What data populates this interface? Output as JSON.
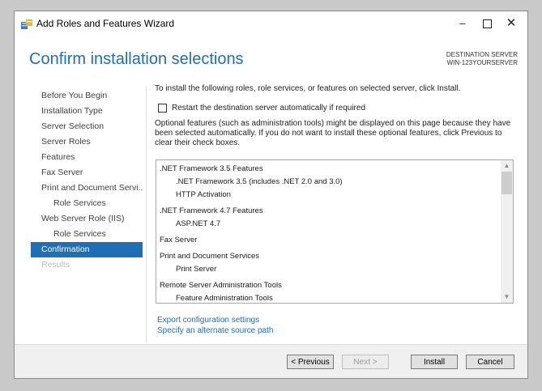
{
  "window": {
    "title": "Add Roles and Features Wizard",
    "icon": "server-manager-icon",
    "controls": {
      "minimize": "–",
      "close": "✕"
    }
  },
  "header": {
    "title": "Confirm installation selections",
    "destination_label": "DESTINATION SERVER",
    "destination_server": "WIN-123YOURSERVER"
  },
  "nav": {
    "items": [
      {
        "label": "Before You Begin",
        "state": "normal"
      },
      {
        "label": "Installation Type",
        "state": "normal"
      },
      {
        "label": "Server Selection",
        "state": "normal"
      },
      {
        "label": "Server Roles",
        "state": "normal"
      },
      {
        "label": "Features",
        "state": "normal"
      },
      {
        "label": "Fax Server",
        "state": "normal"
      },
      {
        "label": "Print and Document Servi...",
        "state": "normal"
      },
      {
        "label": "Role Services",
        "state": "sub"
      },
      {
        "label": "Web Server Role (IIS)",
        "state": "normal"
      },
      {
        "label": "Role Services",
        "state": "sub"
      },
      {
        "label": "Confirmation",
        "state": "active"
      },
      {
        "label": "Results",
        "state": "disabled"
      }
    ]
  },
  "content": {
    "intro": "To install the following roles, role services, or features on selected server, click Install.",
    "restart_checkbox": {
      "label": "Restart the destination server automatically if required",
      "checked": false
    },
    "optional_note": "Optional features (such as administration tools) might be displayed on this page because they have been selected automatically. If you do not want to install these optional features, click Previous to clear their check boxes.",
    "selections": [
      ".NET Framework 3.5 Features",
      ".NET Framework 3.5 (includes .NET 2.0 and 3.0)",
      "HTTP Activation",
      ".NET Framework 4.7 Features",
      "ASP.NET 4.7",
      "Fax Server",
      "Print and Document Services",
      "Print Server",
      "Remote Server Administration Tools",
      "Feature Administration Tools"
    ],
    "links": {
      "export": "Export configuration settings",
      "alternate_source": "Specify an alternate source path"
    }
  },
  "footer": {
    "previous": "< Previous",
    "next": "Next >",
    "install": "Install",
    "cancel": "Cancel"
  },
  "colors": {
    "accent": "#1f6fb4",
    "disabled_text": "#bdbdbd"
  }
}
